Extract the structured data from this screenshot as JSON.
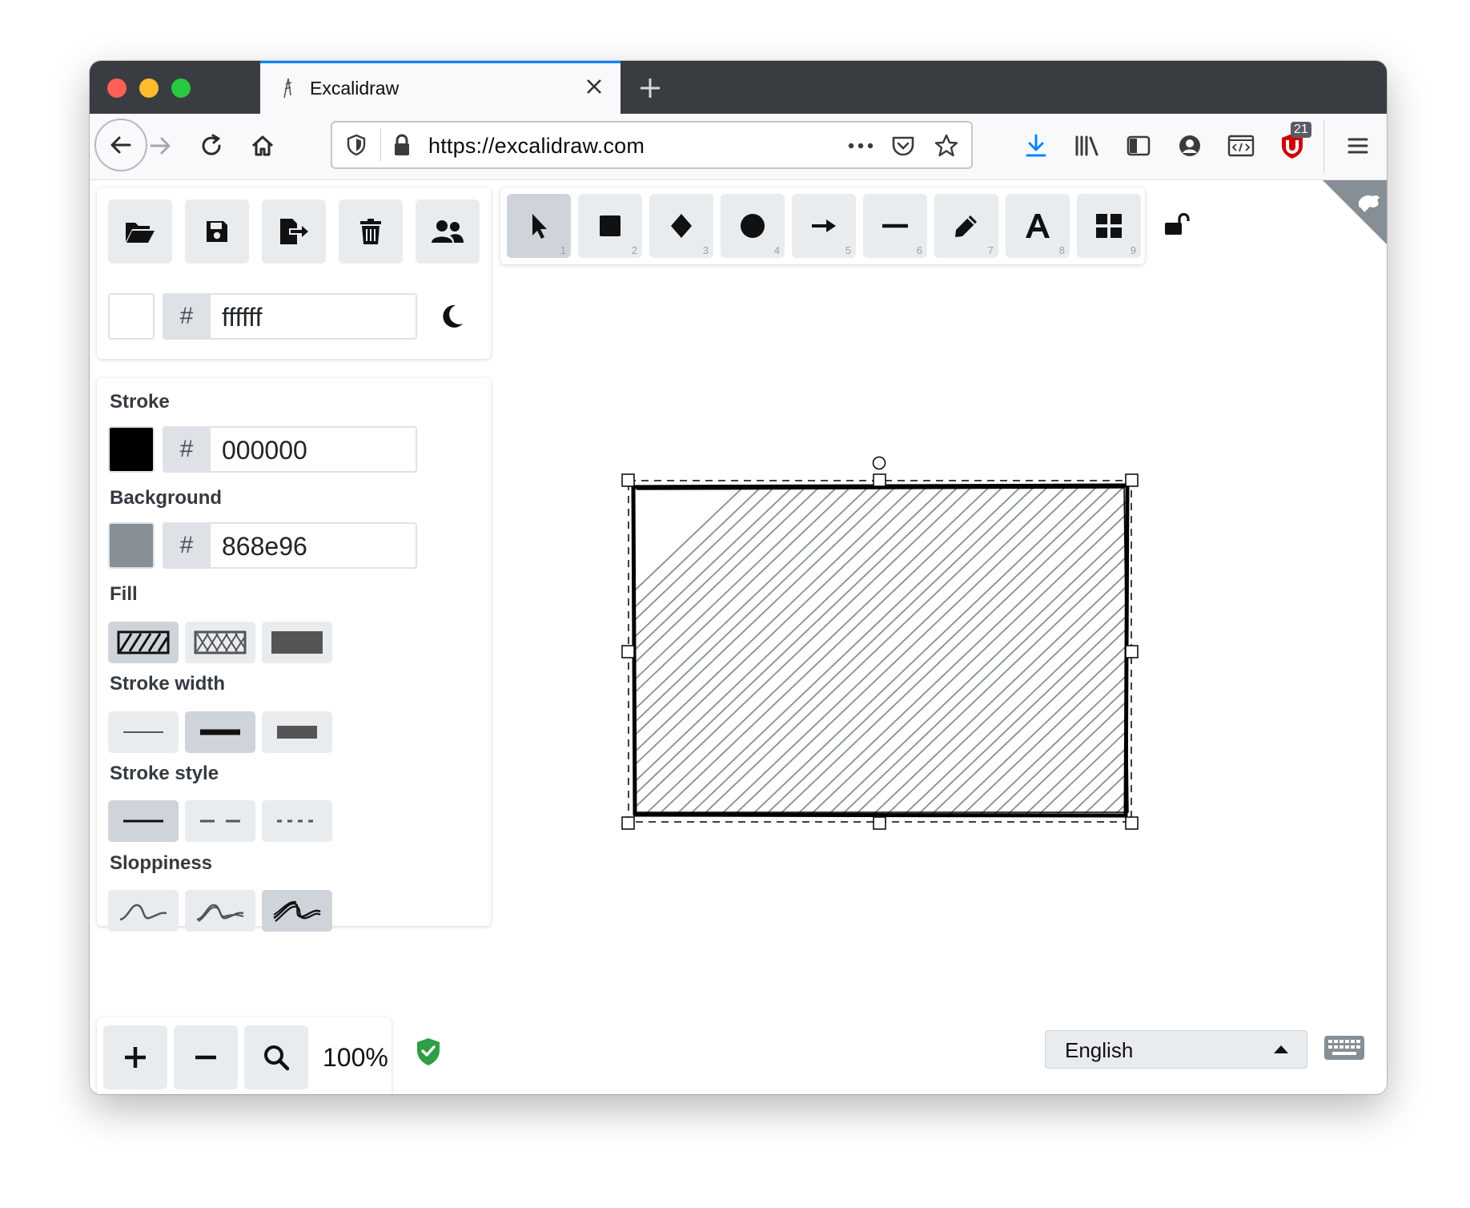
{
  "browser": {
    "tab_title": "Excalidraw",
    "url": "https://excalidraw.com",
    "addon_badge": "21",
    "icons": [
      "back-icon",
      "forward-icon",
      "reload-icon",
      "home-icon",
      "shield-icon",
      "lock-icon",
      "more-icon",
      "pocket-icon",
      "star-icon",
      "download-icon",
      "library-icon",
      "sidebar-icon",
      "account-icon",
      "devtools-icon",
      "ublock-icon",
      "menu-icon"
    ]
  },
  "app": {
    "canvas_bg_hash": "#",
    "canvas_bg_value": "ffffff",
    "stroke": {
      "label": "Stroke",
      "hash": "#",
      "value": "000000",
      "color": "#000000"
    },
    "background": {
      "label": "Background",
      "hash": "#",
      "value": "868e96",
      "color": "#868e96"
    },
    "fill_label": "Fill",
    "stroke_width_label": "Stroke width",
    "stroke_style_label": "Stroke style",
    "sloppiness_label": "Sloppiness",
    "tools": [
      {
        "num": "1",
        "icon": "selection-icon"
      },
      {
        "num": "2",
        "icon": "rectangle-icon"
      },
      {
        "num": "3",
        "icon": "diamond-icon"
      },
      {
        "num": "4",
        "icon": "ellipse-icon"
      },
      {
        "num": "5",
        "icon": "arrow-icon"
      },
      {
        "num": "6",
        "icon": "line-icon"
      },
      {
        "num": "7",
        "icon": "pencil-icon"
      },
      {
        "num": "8",
        "icon": "text-icon"
      },
      {
        "num": "9",
        "icon": "library-icon"
      }
    ],
    "zoom": "100%",
    "language": "English"
  }
}
